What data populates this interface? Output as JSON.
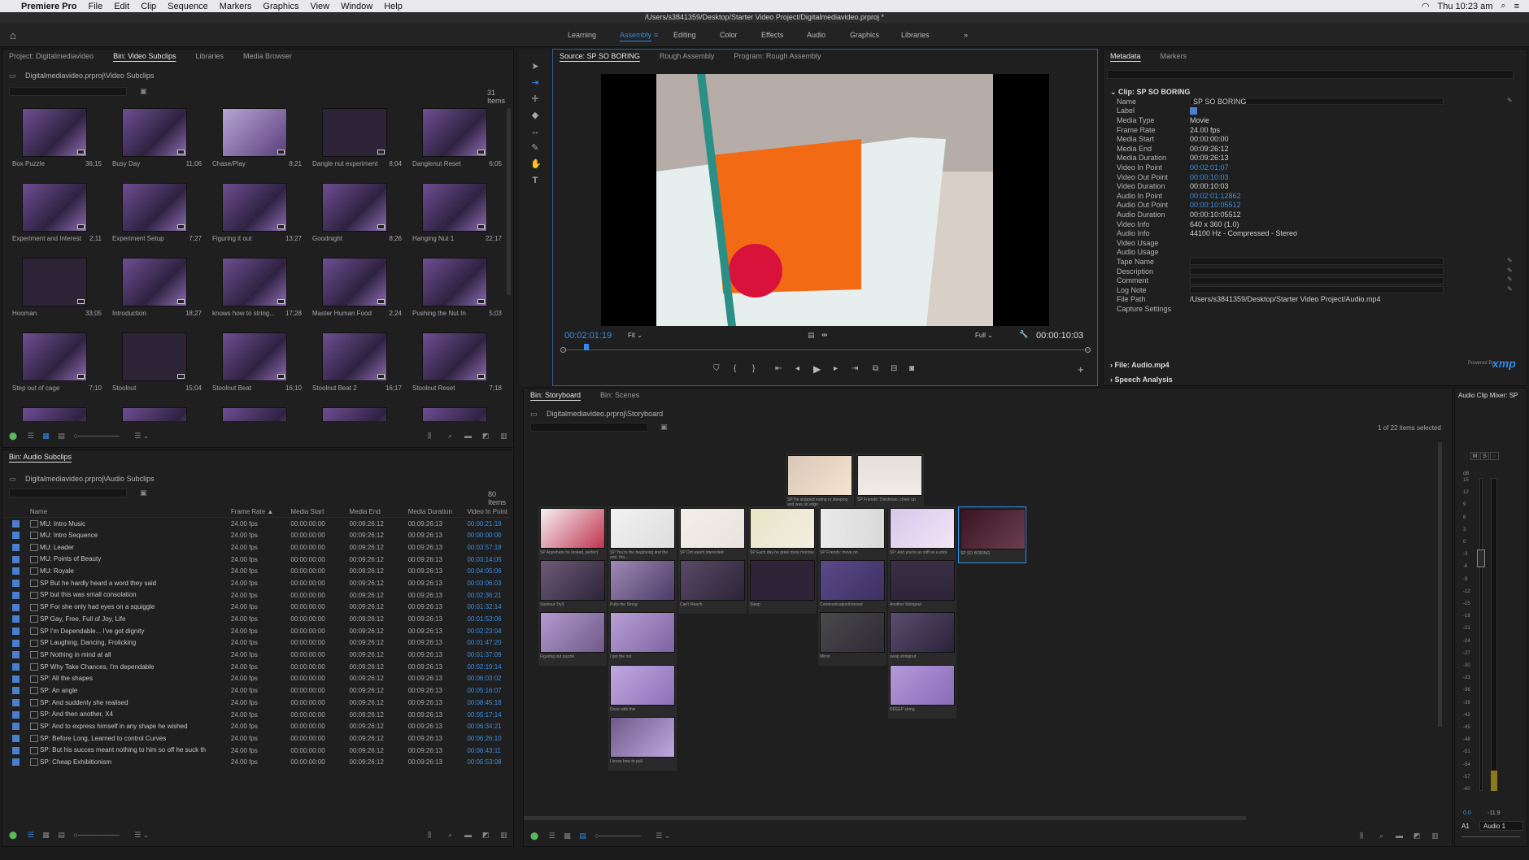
{
  "menubar": {
    "app": "Premiere Pro",
    "items": [
      "File",
      "Edit",
      "Clip",
      "Sequence",
      "Markers",
      "Graphics",
      "View",
      "Window",
      "Help"
    ],
    "clock": "Thu 10:23 am"
  },
  "title": "/Users/s3841359/Desktop/Starter Video Project/Digitalmediavideo.prproj *",
  "workspaces": [
    "Learning",
    "Assembly",
    "Editing",
    "Color",
    "Effects",
    "Audio",
    "Graphics",
    "Libraries"
  ],
  "project": {
    "tabs": [
      "Project: Digitalmediavideo",
      "Bin: Video Subclips",
      "Libraries",
      "Media Browser"
    ],
    "path": "Digitalmediavideo.prproj\\Video Subclips",
    "count": "31 Items",
    "clips": [
      {
        "name": "Box Puzzle",
        "dur": "36;15"
      },
      {
        "name": "Busy Day",
        "dur": "11;06"
      },
      {
        "name": "Chase/Play",
        "dur": "8;21"
      },
      {
        "name": "Dangle nut experiment",
        "dur": "8;04"
      },
      {
        "name": "Danglenut Reset",
        "dur": "6;05"
      },
      {
        "name": "Experiment and Interest",
        "dur": "2;11"
      },
      {
        "name": "Experiment Setup",
        "dur": "7;27"
      },
      {
        "name": "Figuring it out",
        "dur": "13;27"
      },
      {
        "name": "Goodnight",
        "dur": "8;26"
      },
      {
        "name": "Hanging Nut 1",
        "dur": "22;17"
      },
      {
        "name": "Hooman",
        "dur": "33;05"
      },
      {
        "name": "Introduction",
        "dur": "18;27"
      },
      {
        "name": "knows how to string...",
        "dur": "17;28"
      },
      {
        "name": "Master Human Food",
        "dur": "2;24"
      },
      {
        "name": "Pushing the Nut In",
        "dur": "5;03"
      },
      {
        "name": "Step out of cage",
        "dur": "7;10"
      },
      {
        "name": "Stoolnut",
        "dur": "15;04"
      },
      {
        "name": "Stoolnut Beat",
        "dur": "16;10"
      },
      {
        "name": "Stoolnut Beat 2",
        "dur": "16;17"
      },
      {
        "name": "Stoolnut Reset",
        "dur": "7;18"
      }
    ]
  },
  "audiobin": {
    "tab": "Bin: Audio Subclips",
    "path": "Digitalmediavideo.prproj\\Audio Subclips",
    "count": "80 Items",
    "headers": [
      "Name",
      "Frame Rate",
      "Media Start",
      "Media End",
      "Media Duration",
      "Video In Point"
    ],
    "rows": [
      [
        "MU: Intro Music",
        "24.00 fps",
        "00:00:00:00",
        "00:09:26:12",
        "00:09:26:13",
        "00:00:21:19"
      ],
      [
        "MU: Intro Sequence",
        "24.00 fps",
        "00:00:00:00",
        "00:09:26:12",
        "00:09:26:13",
        "00:00:00:00"
      ],
      [
        "MU: Leader",
        "24.00 fps",
        "00:00:00:00",
        "00:09:26:12",
        "00:09:26:13",
        "00:03:57:18"
      ],
      [
        "MU: Points of Beauty",
        "24.00 fps",
        "00:00:00:00",
        "00:09:26:12",
        "00:09:26:13",
        "00:03:14:05"
      ],
      [
        "MU: Royale",
        "24.00 fps",
        "00:00:00:00",
        "00:09:26:12",
        "00:09:26:13",
        "00:04:05:06"
      ],
      [
        "SP But he hardly heard a word they said",
        "24.00 fps",
        "00:00:00:00",
        "00:09:26:12",
        "00:09:26:13",
        "00:03:06:03"
      ],
      [
        "SP but this was small consolation",
        "24.00 fps",
        "00:00:00:00",
        "00:09:26:12",
        "00:09:26:13",
        "00:02:36:21"
      ],
      [
        "SP For she only had eyes on a squiggle",
        "24.00 fps",
        "00:00:00:00",
        "00:09:26:12",
        "00:09:26:13",
        "00:01:32:14"
      ],
      [
        "SP Gay, Free, Full of Joy, Life",
        "24.00 fps",
        "00:00:00:00",
        "00:09:26:12",
        "00:09:26:13",
        "00:01:53:06"
      ],
      [
        "SP I'm Dependable... I've got dignity",
        "24.00 fps",
        "00:00:00:00",
        "00:09:26:12",
        "00:09:26:13",
        "00:02:23:04"
      ],
      [
        "SP Laughing, Dancing, Frolicking",
        "24.00 fps",
        "00:00:00:00",
        "00:09:26:12",
        "00:09:26:13",
        "00:01:47:20"
      ],
      [
        "SP Nothing in mind at all",
        "24.00 fps",
        "00:00:00:00",
        "00:09:26:12",
        "00:09:26:13",
        "00:01:37:09"
      ],
      [
        "SP Why Take Chances, I'm dependable",
        "24.00 fps",
        "00:00:00:00",
        "00:09:26:12",
        "00:09:26:13",
        "00:02:19:14"
      ],
      [
        "SP: All the shapes",
        "24.00 fps",
        "00:00:00:00",
        "00:09:26:12",
        "00:09:26:13",
        "00:06:03:02"
      ],
      [
        "SP: An angle",
        "24.00 fps",
        "00:00:00:00",
        "00:09:26:12",
        "00:09:26:13",
        "00:05:16:07"
      ],
      [
        "SP: And suddenly she realised",
        "24.00 fps",
        "00:00:00:00",
        "00:09:26:12",
        "00:09:26:13",
        "00:08:45:18"
      ],
      [
        "SP: And then another, X4",
        "24.00 fps",
        "00:00:00:00",
        "00:09:26:12",
        "00:09:26:13",
        "00:05:17:14"
      ],
      [
        "SP: And to express himself in any shape he wished",
        "24.00 fps",
        "00:00:00:00",
        "00:09:26:12",
        "00:09:26:13",
        "00:06:34:21"
      ],
      [
        "SP: Before Long, Learned to control Curves",
        "24.00 fps",
        "00:00:00:00",
        "00:09:26:12",
        "00:09:26:13",
        "00:06:26:10"
      ],
      [
        "SP: But his succes meant nothing to him so off he suck th",
        "24.00 fps",
        "00:00:00:00",
        "00:09:26:12",
        "00:09:26:13",
        "00:06:43:11"
      ],
      [
        "SP: Cheap Exhibitionism",
        "24.00 fps",
        "00:00:00:00",
        "00:09:26:12",
        "00:09:26:13",
        "00:05:53:08"
      ]
    ]
  },
  "monitor": {
    "tabs": [
      "Source: SP SO BORING",
      "Rough Assembly",
      "Program: Rough Assembly"
    ],
    "timecode": "00:02:01:19",
    "fit": "Fit",
    "full": "Full",
    "duration": "00:00:10:03"
  },
  "metadata": {
    "tabs": [
      "Metadata",
      "Markers"
    ],
    "clip_header": "Clip: SP SO BORING",
    "rows": [
      {
        "k": "Name",
        "v": "SP SO BORING",
        "box": true
      },
      {
        "k": "Label",
        "v": "",
        "swatch": true
      },
      {
        "k": "Media Type",
        "v": "Movie"
      },
      {
        "k": "Frame Rate",
        "v": "24.00 fps"
      },
      {
        "k": "Media Start",
        "v": "00:00:00:00"
      },
      {
        "k": "Media End",
        "v": "00:09:26:12"
      },
      {
        "k": "Media Duration",
        "v": "00:09:26:13"
      },
      {
        "k": "Video In Point",
        "v": "00:02:01:07",
        "blue": true
      },
      {
        "k": "Video Out Point",
        "v": "00:00:10:03",
        "blue": true
      },
      {
        "k": "Video Duration",
        "v": "00:00:10:03"
      },
      {
        "k": "Audio In Point",
        "v": "00:02:01:12862",
        "blue": true
      },
      {
        "k": "Audio Out Point",
        "v": "00:00:10:05512",
        "blue": true
      },
      {
        "k": "Audio Duration",
        "v": "00:00:10:05512"
      },
      {
        "k": "Video Info",
        "v": "640 x 360 (1.0)"
      },
      {
        "k": "Audio Info",
        "v": "44100 Hz - Compressed - Stereo"
      },
      {
        "k": "Video Usage",
        "v": ""
      },
      {
        "k": "Audio Usage",
        "v": ""
      },
      {
        "k": "Tape Name",
        "v": "",
        "box": true
      },
      {
        "k": "Description",
        "v": "",
        "box": true
      },
      {
        "k": "Comment",
        "v": "",
        "box": true
      },
      {
        "k": "Log Note",
        "v": "",
        "box": true
      },
      {
        "k": "File Path",
        "v": "/Users/s3841359/Desktop/Starter Video Project/Audio.mp4"
      },
      {
        "k": "Capture Settings",
        "v": ""
      }
    ],
    "file_header": "File: Audio.mp4",
    "speech": "Speech Analysis",
    "powered": "Powered By",
    "xmp": "xmp"
  },
  "storyboard": {
    "tabs": [
      "Bin: Storyboard",
      "Bin: Scenes"
    ],
    "path": "Digitalmediavideo.prproj\\Storyboard",
    "selected": "1 of 22 items selected",
    "tiles": [
      {
        "label": "SP He stopped eating or sleeping and was on edge"
      },
      {
        "label": "SP Friends: Thirdrown, cheer up"
      },
      {
        "label": "SP Anywhere he looked, perfect"
      },
      {
        "label": "SP You're the beginning and the end, tha..."
      },
      {
        "label": "SP Dirt wasnt interested"
      },
      {
        "label": "SP Each day he grew more morose"
      },
      {
        "label": "SP Friends: move on"
      },
      {
        "label": "SP: And you're as stiff as a stick"
      },
      {
        "label": "SP SO BORING"
      },
      {
        "label": "Stoolnut Try3"
      },
      {
        "label": "Pulls the String"
      },
      {
        "label": "Can't Reach"
      },
      {
        "label": "Sleep"
      },
      {
        "label": "Communication/Interest"
      },
      {
        "label": "Another Stringnut"
      },
      {
        "label": "Figuring out puzzle"
      },
      {
        "label": "I got the nut"
      },
      {
        "label": "Mirror"
      },
      {
        "label": "swap stringnut"
      },
      {
        "label": "Done with this"
      },
      {
        "label": "DEEEP string"
      },
      {
        "label": "I know how to pull"
      }
    ]
  },
  "mixer": {
    "title": "Audio Clip Mixer: SP",
    "m": "M",
    "s": "S",
    "db_label": "dB",
    "scale": [
      "15",
      "12",
      "9",
      "6",
      "3",
      "0",
      "-3",
      "-6",
      "-9",
      "-12",
      "-15",
      "-18",
      "-21",
      "-24",
      "-27",
      "-30",
      "-33",
      "-36",
      "-39",
      "-42",
      "-45",
      "-48",
      "-51",
      "-54",
      "-57",
      "-60"
    ],
    "val_left": "0.0",
    "val_right": "-11.9",
    "track": "A1",
    "audio": "Audio 1"
  }
}
